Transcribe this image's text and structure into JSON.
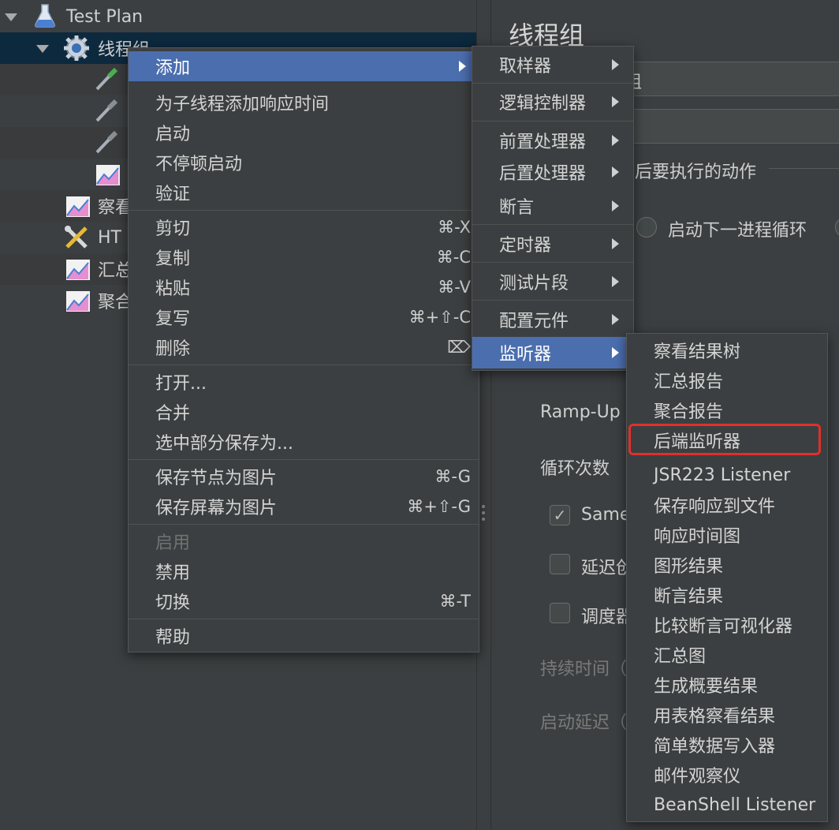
{
  "tree": {
    "items": [
      {
        "label": "Test Plan",
        "icon": "flask-icon"
      },
      {
        "label": "线程组",
        "icon": "gear-icon"
      },
      {
        "label": "",
        "icon": "pipette-icon"
      },
      {
        "label": "",
        "icon": "pipette-icon"
      },
      {
        "label": "",
        "icon": "pipette-icon"
      },
      {
        "label": "",
        "icon": "graph-icon"
      },
      {
        "label": "察看",
        "icon": "graph-icon"
      },
      {
        "label": "HT",
        "icon": "wrench-icon"
      },
      {
        "label": "汇总",
        "icon": "graph-icon"
      },
      {
        "label": "聚合",
        "icon": "graph-icon"
      }
    ]
  },
  "form": {
    "title": "线程组",
    "name_fragment": "组",
    "action_fragment": "后要执行的动作",
    "radio_next_loop": "启动下一进程循环",
    "ramp_up": "Ramp-Up",
    "loop_count": "循环次数",
    "same_user": "Same",
    "delay": "延迟创",
    "scheduler": "调度器",
    "duration": "持续时间（",
    "startup_delay": "启动延迟（"
  },
  "context_menu": {
    "items": [
      {
        "label": "添加",
        "shortcut": "",
        "submenu": true
      },
      {
        "label": "为子线程添加响应时间",
        "shortcut": ""
      },
      {
        "label": "启动",
        "shortcut": ""
      },
      {
        "label": "不停顿启动",
        "shortcut": ""
      },
      {
        "label": "验证",
        "shortcut": ""
      },
      {
        "label": "剪切",
        "shortcut": "⌘-X"
      },
      {
        "label": "复制",
        "shortcut": "⌘-C"
      },
      {
        "label": "粘贴",
        "shortcut": "⌘-V"
      },
      {
        "label": "复写",
        "shortcut": "⌘+⇧-C"
      },
      {
        "label": "删除",
        "shortcut": "⌦"
      },
      {
        "label": "打开...",
        "shortcut": ""
      },
      {
        "label": "合并",
        "shortcut": ""
      },
      {
        "label": "选中部分保存为...",
        "shortcut": ""
      },
      {
        "label": "保存节点为图片",
        "shortcut": "⌘-G"
      },
      {
        "label": "保存屏幕为图片",
        "shortcut": "⌘+⇧-G"
      },
      {
        "label": "启用",
        "shortcut": "",
        "disabled": true
      },
      {
        "label": "禁用",
        "shortcut": ""
      },
      {
        "label": "切换",
        "shortcut": "⌘-T"
      },
      {
        "label": "帮助",
        "shortcut": ""
      }
    ]
  },
  "add_submenu": {
    "items": [
      {
        "label": "取样器"
      },
      {
        "label": "逻辑控制器"
      },
      {
        "label": "前置处理器"
      },
      {
        "label": "后置处理器"
      },
      {
        "label": "断言"
      },
      {
        "label": "定时器"
      },
      {
        "label": "测试片段"
      },
      {
        "label": "配置元件"
      },
      {
        "label": "监听器"
      }
    ]
  },
  "listener_submenu": {
    "items": [
      {
        "label": "察看结果树"
      },
      {
        "label": "汇总报告"
      },
      {
        "label": "聚合报告"
      },
      {
        "label": "后端监听器"
      },
      {
        "label": "JSR223 Listener"
      },
      {
        "label": "保存响应到文件"
      },
      {
        "label": "响应时间图"
      },
      {
        "label": "图形结果"
      },
      {
        "label": "断言结果"
      },
      {
        "label": "比较断言可视化器"
      },
      {
        "label": "汇总图"
      },
      {
        "label": "生成概要结果"
      },
      {
        "label": "用表格察看结果"
      },
      {
        "label": "简单数据写入器"
      },
      {
        "label": "邮件观察仪"
      },
      {
        "label": "BeanShell Listener"
      }
    ]
  },
  "colors": {
    "menu_highlight": "#4b6eaf",
    "callout_border": "#e0302a",
    "selection": "#0d293e"
  }
}
